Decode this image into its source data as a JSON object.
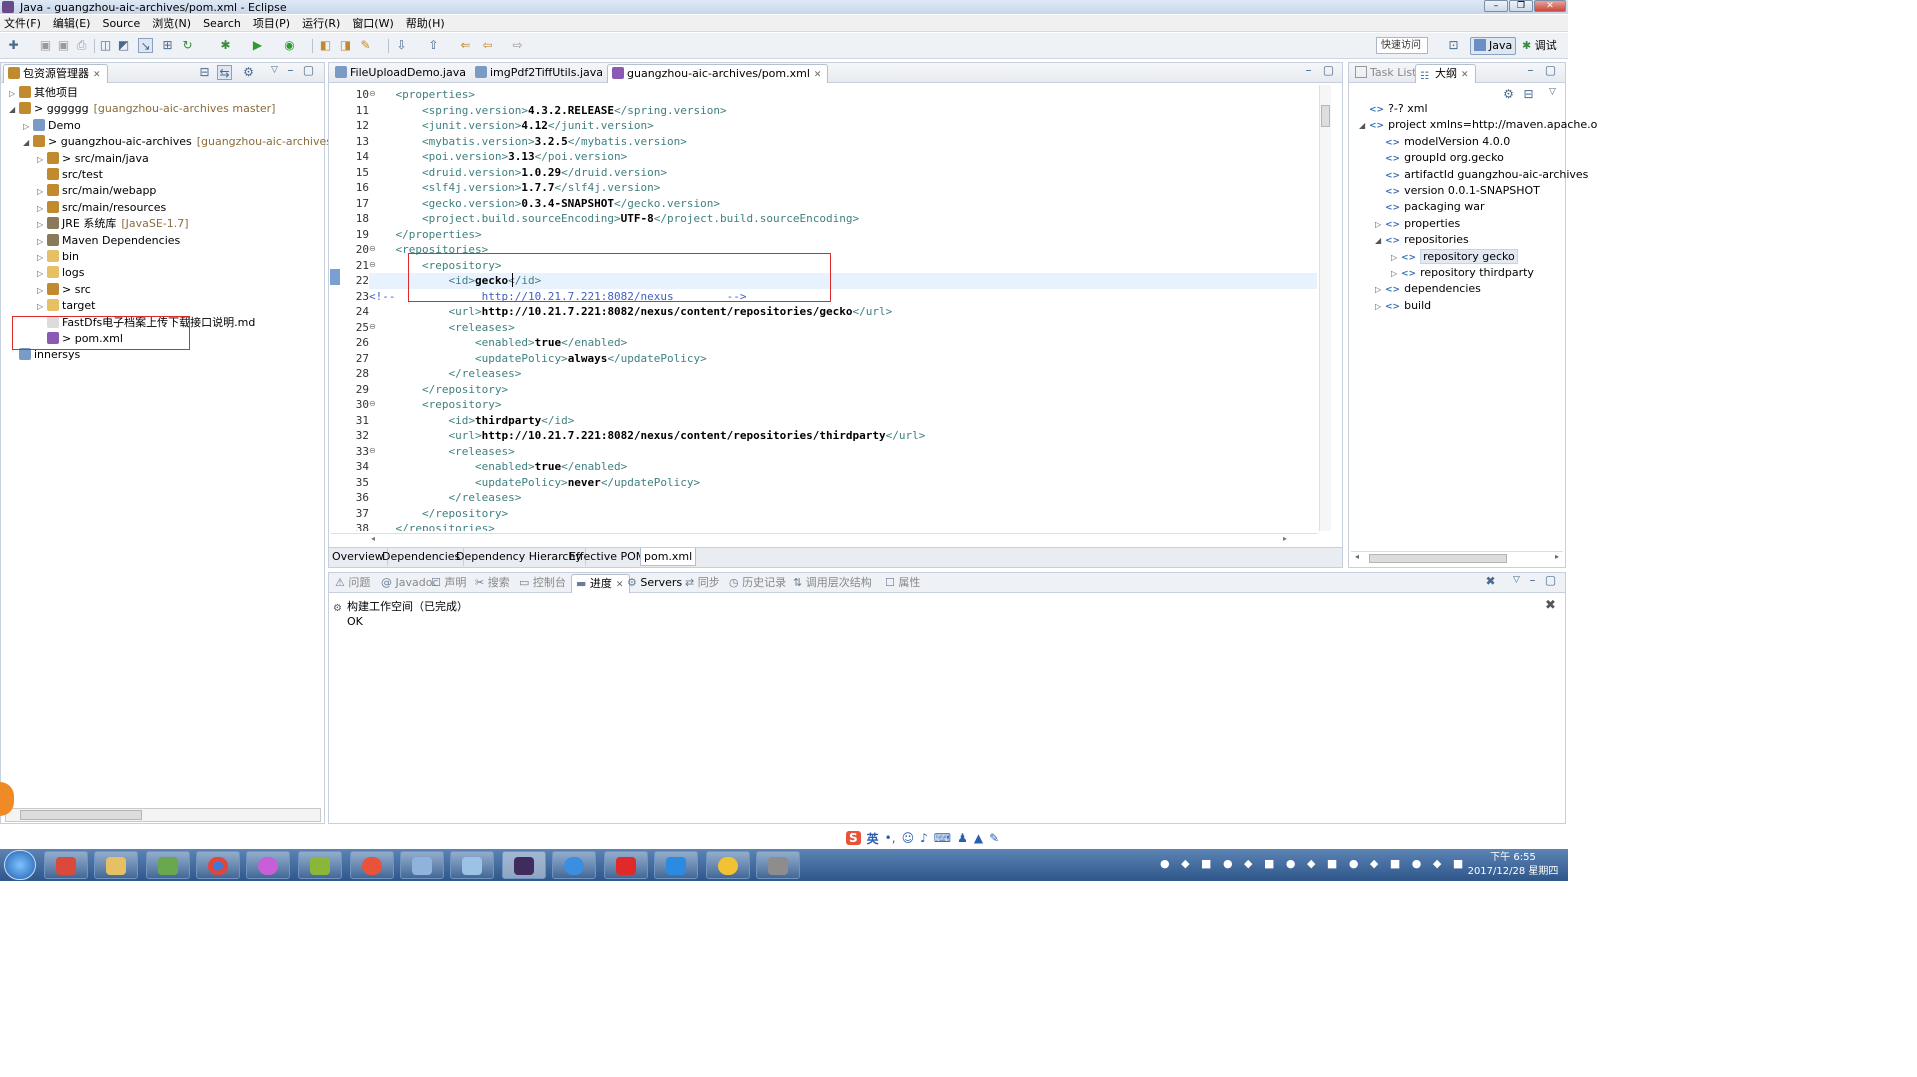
{
  "window": {
    "title": "Java - guangzhou-aic-archives/pom.xml - Eclipse"
  },
  "menubar": [
    "文件(F)",
    "编辑(E)",
    "Source",
    "浏览(N)",
    "Search",
    "项目(P)",
    "运行(R)",
    "窗口(W)",
    "帮助(H)"
  ],
  "toolbar": {
    "quick_access": "快速访问",
    "perspectives": [
      "Java",
      "调试"
    ]
  },
  "package_explorer": {
    "title": "包资源管理器",
    "items": [
      {
        "label": "其他项目",
        "deco": "",
        "indent": 0,
        "arrow": "▷"
      },
      {
        "label": "> gggggg",
        "deco": "[guangzhou-aic-archives master]",
        "indent": 0,
        "arrow": "◢"
      },
      {
        "label": "Demo",
        "deco": "",
        "indent": 1,
        "arrow": "▷"
      },
      {
        "label": "> guangzhou-aic-archives",
        "deco": "[guangzhou-aic-archives mas",
        "indent": 1,
        "arrow": "◢"
      },
      {
        "label": "> src/main/java",
        "deco": "",
        "indent": 2,
        "arrow": "▷"
      },
      {
        "label": "src/test",
        "deco": "",
        "indent": 2,
        "arrow": ""
      },
      {
        "label": "src/main/webapp",
        "deco": "",
        "indent": 2,
        "arrow": "▷"
      },
      {
        "label": "src/main/resources",
        "deco": "",
        "indent": 2,
        "arrow": "▷"
      },
      {
        "label": "JRE 系统库",
        "deco": "[JavaSE-1.7]",
        "indent": 2,
        "arrow": "▷"
      },
      {
        "label": "Maven Dependencies",
        "deco": "",
        "indent": 2,
        "arrow": "▷"
      },
      {
        "label": "bin",
        "deco": "",
        "indent": 2,
        "arrow": "▷"
      },
      {
        "label": "logs",
        "deco": "",
        "indent": 2,
        "arrow": "▷"
      },
      {
        "label": "> src",
        "deco": "",
        "indent": 2,
        "arrow": "▷"
      },
      {
        "label": "target",
        "deco": "",
        "indent": 2,
        "arrow": "▷"
      },
      {
        "label": "FastDfs电子档案上传下载接口说明.md",
        "deco": "",
        "indent": 2,
        "arrow": ""
      },
      {
        "label": "> pom.xml",
        "deco": "",
        "indent": 2,
        "arrow": ""
      },
      {
        "label": "innersys",
        "deco": "",
        "indent": 0,
        "arrow": ""
      }
    ]
  },
  "editor_tabs": [
    {
      "label": "FileUploadDemo.java",
      "selected": false
    },
    {
      "label": "imgPdf2TiffUtils.java",
      "selected": false
    },
    {
      "label": "guangzhou-aic-archives/pom.xml",
      "selected": true
    }
  ],
  "editor": {
    "lines": [
      {
        "n": "10",
        "code": "    <properties>",
        "fold": true
      },
      {
        "n": "11",
        "code": "        <spring.version>4.3.2.RELEASE</spring.version>"
      },
      {
        "n": "12",
        "code": "        <junit.version>4.12</junit.version>"
      },
      {
        "n": "13",
        "code": "        <mybatis.version>3.2.5</mybatis.version>"
      },
      {
        "n": "14",
        "code": "        <poi.version>3.13</poi.version>"
      },
      {
        "n": "15",
        "code": "        <druid.version>1.0.29</druid.version>"
      },
      {
        "n": "16",
        "code": "        <slf4j.version>1.7.7</slf4j.version>"
      },
      {
        "n": "17",
        "code": "        <gecko.version>0.3.4-SNAPSHOT</gecko.version>"
      },
      {
        "n": "18",
        "code": "        <project.build.sourceEncoding>UTF-8</project.build.sourceEncoding>"
      },
      {
        "n": "19",
        "code": "    </properties>"
      },
      {
        "n": "20",
        "code": "    <repositories>",
        "fold": true
      },
      {
        "n": "21",
        "code": "        <repository>",
        "fold": true
      },
      {
        "n": "22",
        "code": "            <id>gecko</id>",
        "current": true
      },
      {
        "n": "23",
        "code": "<!--             http://10.21.7.221:8082/nexus        -->",
        "comment": true
      },
      {
        "n": "24",
        "code": "            <url>http://10.21.7.221:8082/nexus/content/repositories/gecko</url>"
      },
      {
        "n": "25",
        "code": "            <releases>",
        "fold": true
      },
      {
        "n": "26",
        "code": "                <enabled>true</enabled>"
      },
      {
        "n": "27",
        "code": "                <updatePolicy>always</updatePolicy>"
      },
      {
        "n": "28",
        "code": "            </releases>"
      },
      {
        "n": "29",
        "code": "        </repository>"
      },
      {
        "n": "30",
        "code": "        <repository>",
        "fold": true
      },
      {
        "n": "31",
        "code": "            <id>thirdparty</id>"
      },
      {
        "n": "32",
        "code": "            <url>http://10.21.7.221:8082/nexus/content/repositories/thirdparty</url>"
      },
      {
        "n": "33",
        "code": "            <releases>",
        "fold": true
      },
      {
        "n": "34",
        "code": "                <enabled>true</enabled>"
      },
      {
        "n": "35",
        "code": "                <updatePolicy>never</updatePolicy>"
      },
      {
        "n": "36",
        "code": "            </releases>"
      },
      {
        "n": "37",
        "code": "        </repository>"
      },
      {
        "n": "38",
        "code": "    </repositories>"
      }
    ]
  },
  "pom_tabs": [
    "Overview",
    "Dependencies",
    "Dependency Hierarchy",
    "Effective POM",
    "pom.xml"
  ],
  "outline": {
    "tabs": [
      "Task List",
      "大纲"
    ],
    "items": [
      {
        "label": "?-? xml",
        "indent": 0,
        "arrow": ""
      },
      {
        "label": "project xmlns=http://maven.apache.o",
        "indent": 0,
        "arrow": "◢"
      },
      {
        "label": "modelVersion  4.0.0",
        "indent": 1,
        "arrow": ""
      },
      {
        "label": "groupId  org.gecko",
        "indent": 1,
        "arrow": ""
      },
      {
        "label": "artifactId  guangzhou-aic-archives",
        "indent": 1,
        "arrow": ""
      },
      {
        "label": "version  0.0.1-SNAPSHOT",
        "indent": 1,
        "arrow": ""
      },
      {
        "label": "packaging  war",
        "indent": 1,
        "arrow": ""
      },
      {
        "label": "properties",
        "indent": 1,
        "arrow": "▷"
      },
      {
        "label": "repositories",
        "indent": 1,
        "arrow": "◢"
      },
      {
        "label": "repository  gecko",
        "indent": 2,
        "arrow": "▷",
        "selected": true
      },
      {
        "label": "repository  thirdparty",
        "indent": 2,
        "arrow": "▷"
      },
      {
        "label": "dependencies",
        "indent": 1,
        "arrow": "▷"
      },
      {
        "label": "build",
        "indent": 1,
        "arrow": "▷"
      }
    ]
  },
  "bottom_tabs": [
    "问题",
    "Javadoc",
    "声明",
    "搜索",
    "控制台",
    "进度",
    "Servers",
    "同步",
    "历史记录",
    "调用层次结构",
    "属性"
  ],
  "progress": {
    "task": "构建工作空间（已完成）",
    "status": "OK"
  },
  "ime": {
    "mode": "英"
  },
  "tray": {
    "time": "下午 6:55",
    "date": "2017/12/28 星期四"
  },
  "colors": {
    "accent": "#3b6fb6",
    "highlight_box": "#e02a2a",
    "current_line": "#e8f2fe"
  }
}
